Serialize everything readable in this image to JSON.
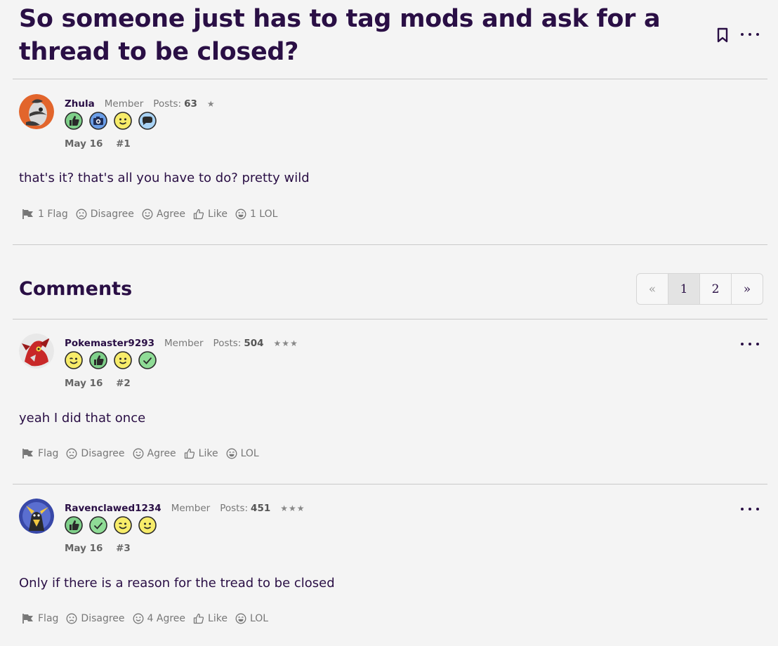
{
  "thread": {
    "title": "So someone just has to tag mods and ask for a thread to be closed?"
  },
  "original_post": {
    "username": "Zhula",
    "role": "Member",
    "posts_label": "Posts:",
    "posts_count": "63",
    "stars": "★",
    "badges": [
      "thumbs-up-badge-icon",
      "camera-badge-icon",
      "smile-badge-icon",
      "speech-bubble-badge-icon"
    ],
    "date": "May 16",
    "number": "#1",
    "body": "that's it? that's all you have to do? pretty wild",
    "actions": {
      "flag": "1 Flag",
      "disagree": "Disagree",
      "agree": "Agree",
      "like": "Like",
      "lol": "1 LOL"
    }
  },
  "comments_section": {
    "title": "Comments",
    "pagination": {
      "prev": "«",
      "pages": [
        "1",
        "2"
      ],
      "current": "1",
      "next": "»"
    }
  },
  "comments": [
    {
      "username": "Pokemaster9293",
      "role": "Member",
      "posts_label": "Posts:",
      "posts_count": "504",
      "stars": "★★★",
      "badges": [
        "wink-badge-icon",
        "thumbs-up-badge-icon",
        "smile-badge-icon",
        "check-badge-icon"
      ],
      "date": "May 16",
      "number": "#2",
      "body": "yeah I did that once",
      "actions": {
        "flag": "Flag",
        "disagree": "Disagree",
        "agree": "Agree",
        "like": "Like",
        "lol": "LOL"
      }
    },
    {
      "username": "Ravenclawed1234",
      "role": "Member",
      "posts_label": "Posts:",
      "posts_count": "451",
      "stars": "★★★",
      "badges": [
        "thumbs-up-badge-icon",
        "check-badge-icon",
        "wink-badge-icon",
        "smile-badge-icon"
      ],
      "date": "May 16",
      "number": "#3",
      "body": "Only if there is a reason for the tread to be closed",
      "actions": {
        "flag": "Flag",
        "disagree": "Disagree",
        "agree": "4 Agree",
        "like": "Like",
        "lol": "LOL"
      }
    }
  ],
  "colors": {
    "background": "#f4f4f4",
    "title": "#2a0f45",
    "muted": "#777777",
    "badge_green": "#7fd08a",
    "badge_blue": "#6b9ee8",
    "badge_yellow": "#f7ec6a",
    "badge_lightblue": "#a9d3f5"
  }
}
